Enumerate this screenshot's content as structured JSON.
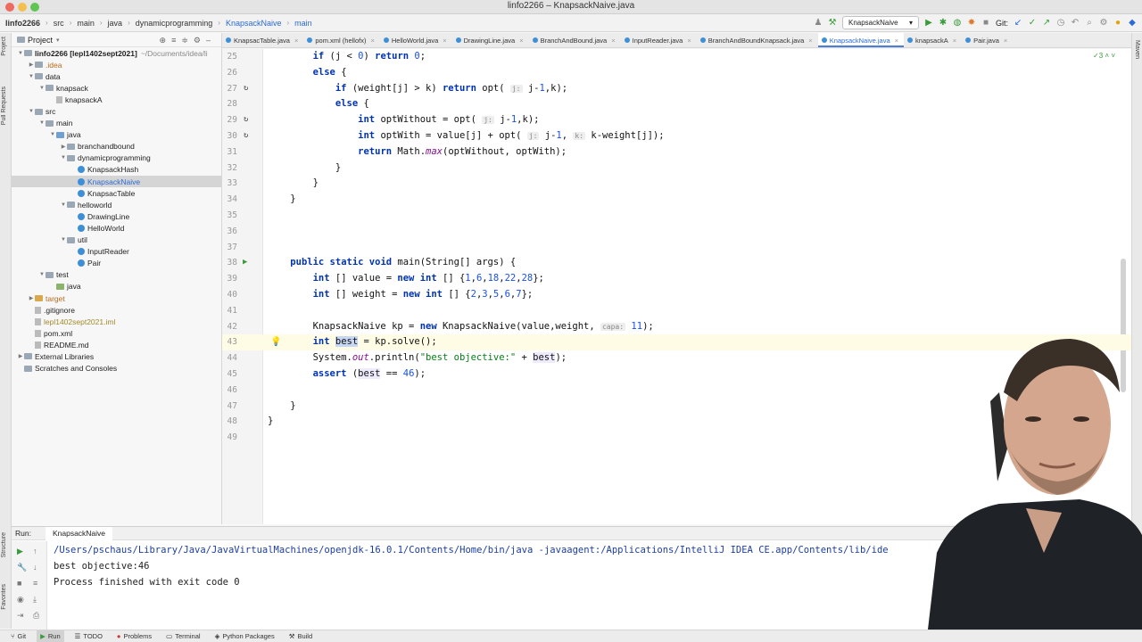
{
  "window": {
    "title": "linfo2266 – KnapsackNaive.java"
  },
  "breadcrumb": [
    "linfo2266",
    "src",
    "main",
    "java",
    "dynamicprogramming",
    "KnapsackNaive",
    "main"
  ],
  "toolbar": {
    "run_config": "KnapsackNaive",
    "git_label": "Git:"
  },
  "project_panel": {
    "title": "Project",
    "tree": [
      {
        "label": "linfo2266 [lepl1402sept2021]",
        "suffix": "~/Documents/idea/li",
        "indent": 0,
        "kind": "folder-root",
        "open": true
      },
      {
        "label": ".idea",
        "indent": 1,
        "kind": "folder",
        "open": false,
        "color": "orange"
      },
      {
        "label": "data",
        "indent": 1,
        "kind": "folder",
        "open": true
      },
      {
        "label": "knapsack",
        "indent": 2,
        "kind": "folder",
        "open": true
      },
      {
        "label": "knapsackA",
        "indent": 3,
        "kind": "file"
      },
      {
        "label": "src",
        "indent": 1,
        "kind": "folder",
        "open": true
      },
      {
        "label": "main",
        "indent": 2,
        "kind": "folder",
        "open": true
      },
      {
        "label": "java",
        "indent": 3,
        "kind": "src",
        "open": true
      },
      {
        "label": "branchandbound",
        "indent": 4,
        "kind": "folder",
        "open": false
      },
      {
        "label": "dynamicprogramming",
        "indent": 4,
        "kind": "folder",
        "open": true
      },
      {
        "label": "KnapsackHash",
        "indent": 5,
        "kind": "class"
      },
      {
        "label": "KnapsackNaive",
        "indent": 5,
        "kind": "class",
        "selected": true
      },
      {
        "label": "KnapsacTable",
        "indent": 5,
        "kind": "class"
      },
      {
        "label": "helloworld",
        "indent": 4,
        "kind": "folder",
        "open": true
      },
      {
        "label": "DrawingLine",
        "indent": 5,
        "kind": "class"
      },
      {
        "label": "HelloWorld",
        "indent": 5,
        "kind": "class"
      },
      {
        "label": "util",
        "indent": 4,
        "kind": "folder",
        "open": true
      },
      {
        "label": "InputReader",
        "indent": 5,
        "kind": "class"
      },
      {
        "label": "Pair",
        "indent": 5,
        "kind": "class"
      },
      {
        "label": "test",
        "indent": 2,
        "kind": "folder",
        "open": true
      },
      {
        "label": "java",
        "indent": 3,
        "kind": "test"
      },
      {
        "label": "target",
        "indent": 1,
        "kind": "target",
        "open": false,
        "color": "orange"
      },
      {
        "label": ".gitignore",
        "indent": 1,
        "kind": "file"
      },
      {
        "label": "lepl1402sept2021.iml",
        "indent": 1,
        "kind": "file",
        "color": "gold"
      },
      {
        "label": "pom.xml",
        "indent": 1,
        "kind": "file"
      },
      {
        "label": "README.md",
        "indent": 1,
        "kind": "file"
      },
      {
        "label": "External Libraries",
        "indent": 0,
        "kind": "folder",
        "open": false
      },
      {
        "label": "Scratches and Consoles",
        "indent": 0,
        "kind": "folder",
        "open": null
      }
    ]
  },
  "tabs": [
    {
      "label": "KnapsacTable.java"
    },
    {
      "label": "pom.xml (hellofx)"
    },
    {
      "label": "HelloWorld.java"
    },
    {
      "label": "DrawingLine.java"
    },
    {
      "label": "BranchAndBound.java"
    },
    {
      "label": "InputReader.java"
    },
    {
      "label": "BranchAndBoundKnapsack.java"
    },
    {
      "label": "KnapsackNaive.java",
      "active": true
    },
    {
      "label": "knapsackA"
    },
    {
      "label": "Pair.java"
    }
  ],
  "editor": {
    "lines": [
      "25",
      "26",
      "27",
      "28",
      "29",
      "30",
      "31",
      "32",
      "33",
      "34",
      "35",
      "36",
      "37",
      "38",
      "39",
      "40",
      "41",
      "42",
      "43",
      "44",
      "45",
      "46",
      "47",
      "48",
      "49"
    ],
    "inspection_count": "3",
    "hints": {
      "j": "j:",
      "k": "k:",
      "capa": "capa:"
    }
  },
  "run_panel": {
    "label": "Run:",
    "tab": "KnapsackNaive",
    "output": [
      "/Users/pschaus/Library/Java/JavaVirtualMachines/openjdk-16.0.1/Contents/Home/bin/java -javaagent:/Applications/IntelliJ IDEA CE.app/Contents/lib/ide",
      "best objective:46",
      "",
      "Process finished with exit code 0"
    ]
  },
  "bottom_bar": [
    "Git",
    "Run",
    "TODO",
    "Problems",
    "Terminal",
    "Python Packages",
    "Build"
  ],
  "side_labels": {
    "left_top": "Project",
    "left_mid": "Pull Requests",
    "left_bottom1": "Structure",
    "left_bottom2": "Favorites",
    "right": "Maven"
  }
}
